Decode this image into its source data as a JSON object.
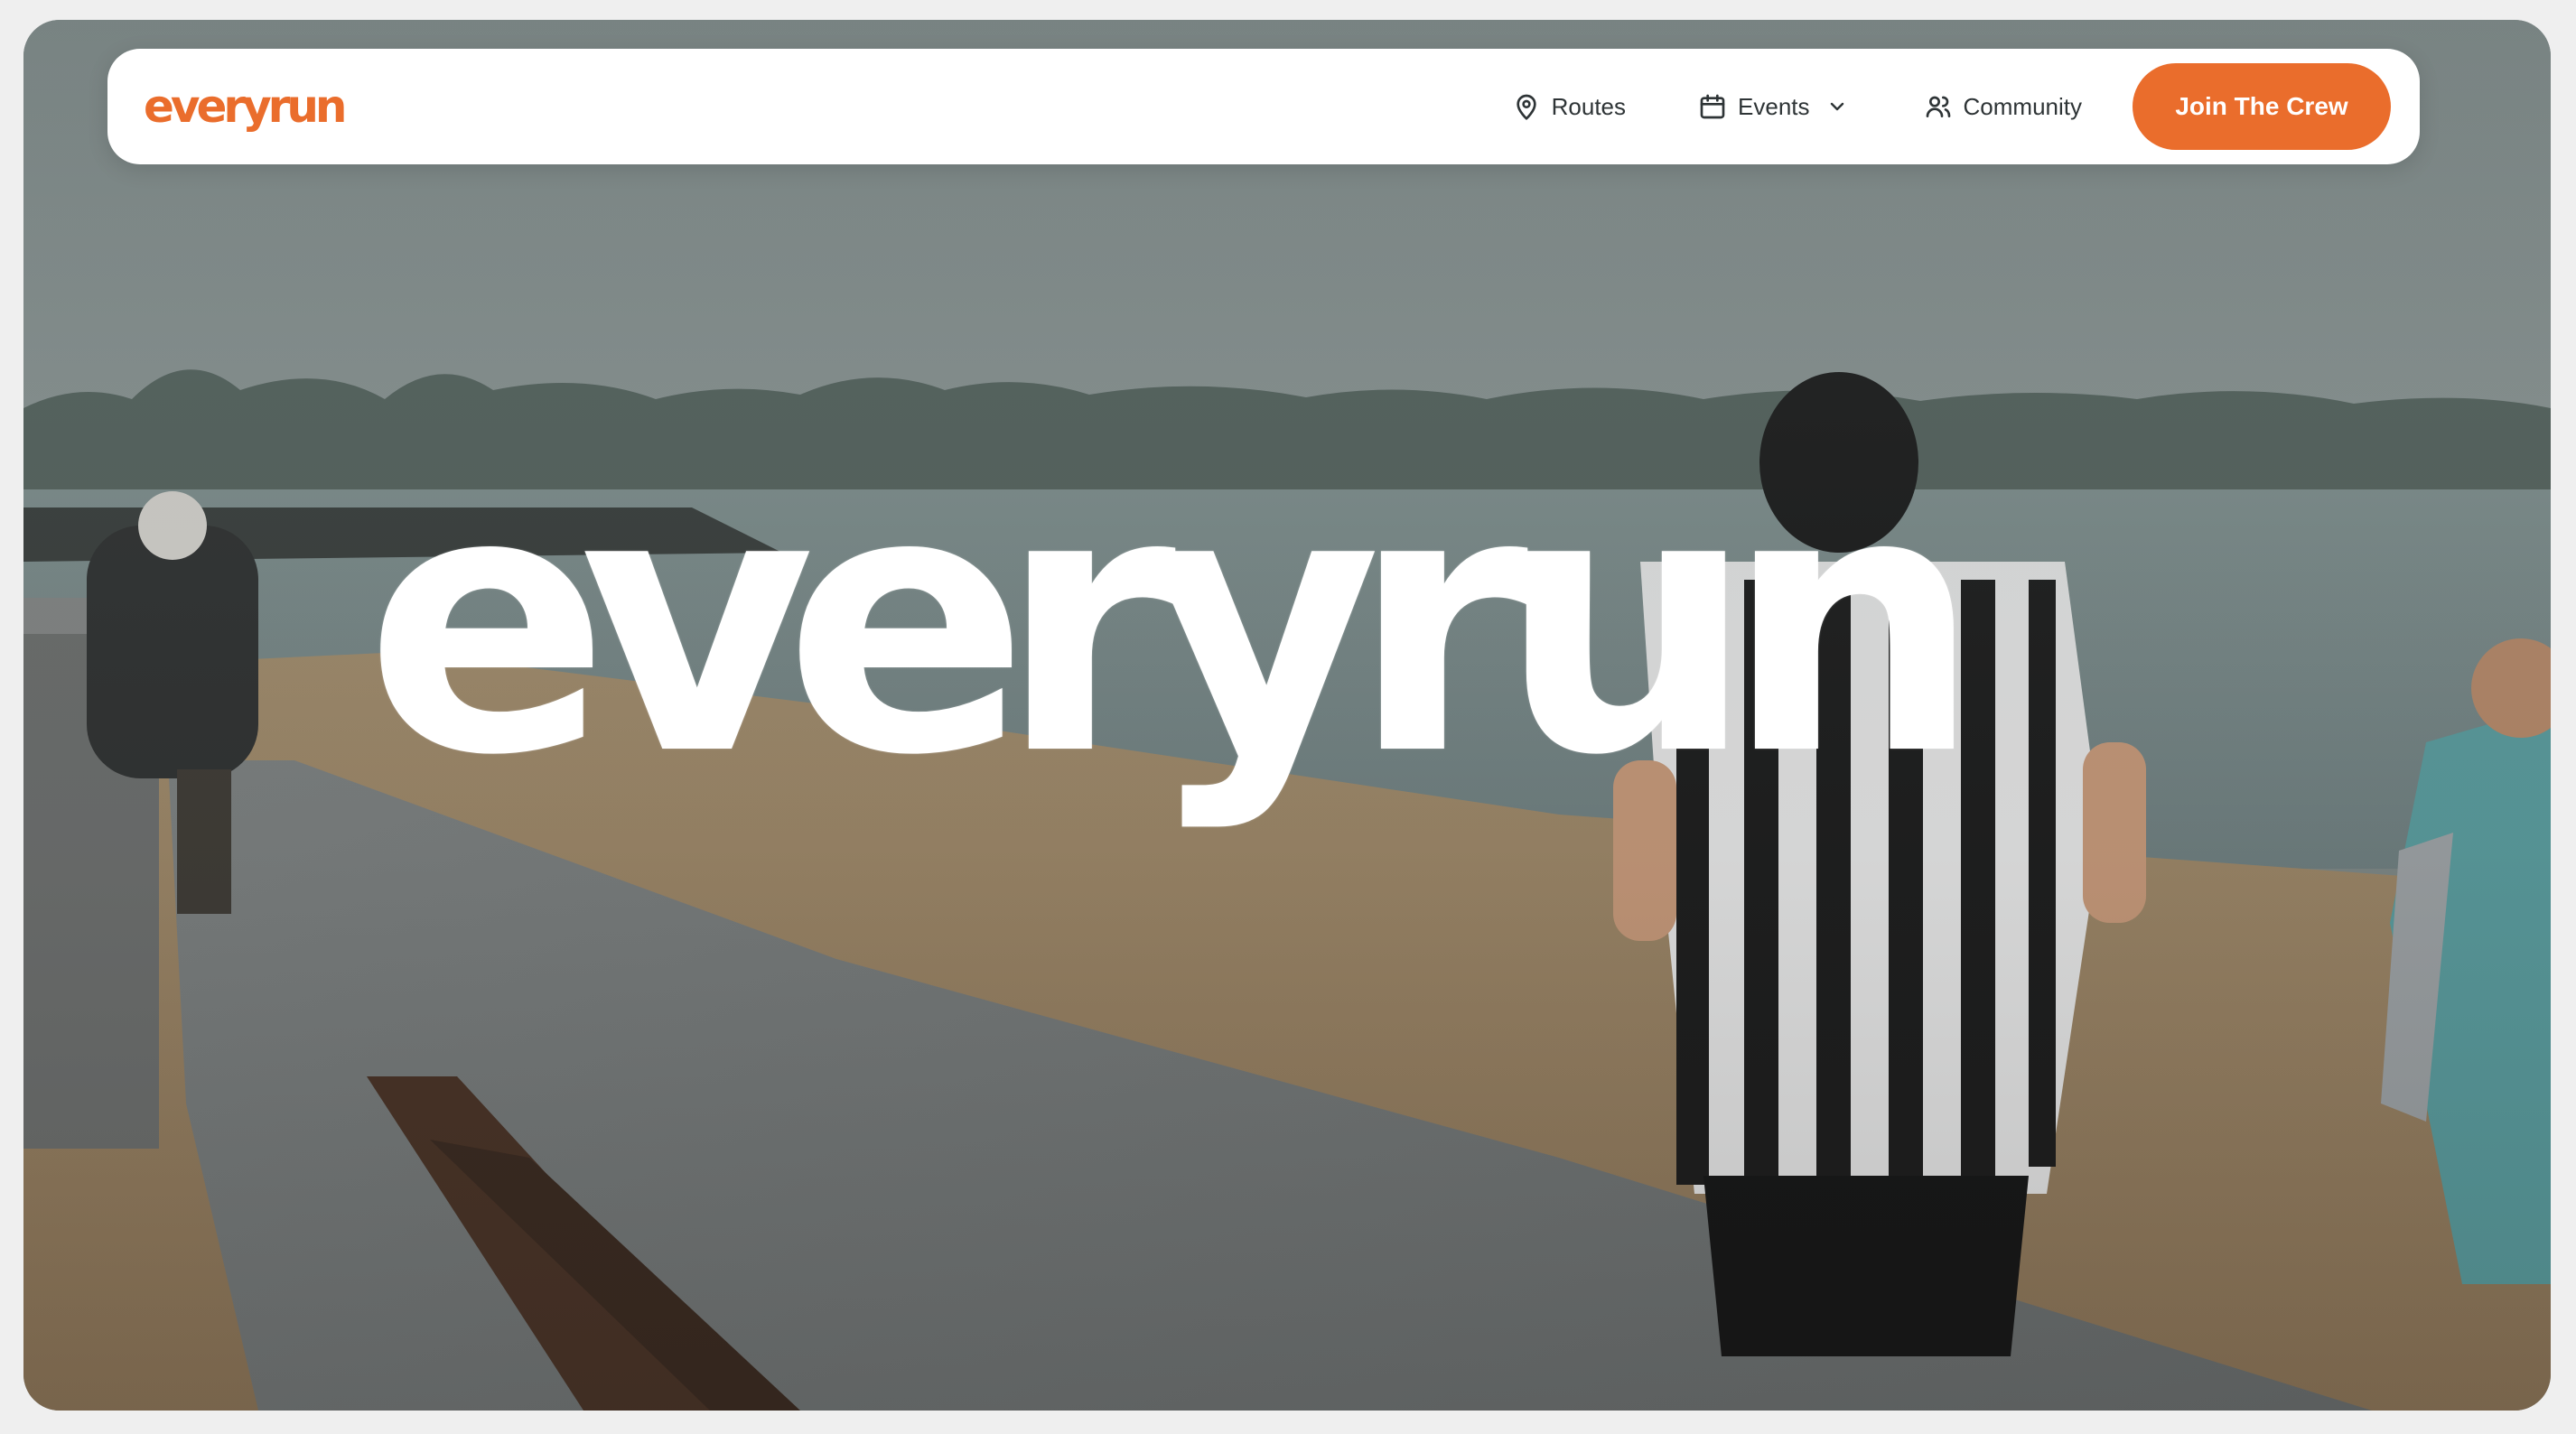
{
  "brand": {
    "logo_text": "everyrun",
    "accent_color": "#ea6d2c"
  },
  "nav": {
    "items": [
      {
        "label": "Routes",
        "icon": "map-pin-icon"
      },
      {
        "label": "Events",
        "icon": "calendar-icon",
        "dropdown_icon": "chevron-down-icon"
      },
      {
        "label": "Community",
        "icon": "users-icon"
      }
    ],
    "cta_label": "Join The Crew"
  },
  "hero": {
    "wordmark": "everyrun",
    "background": "runners-on-beach-promenade-photo"
  }
}
